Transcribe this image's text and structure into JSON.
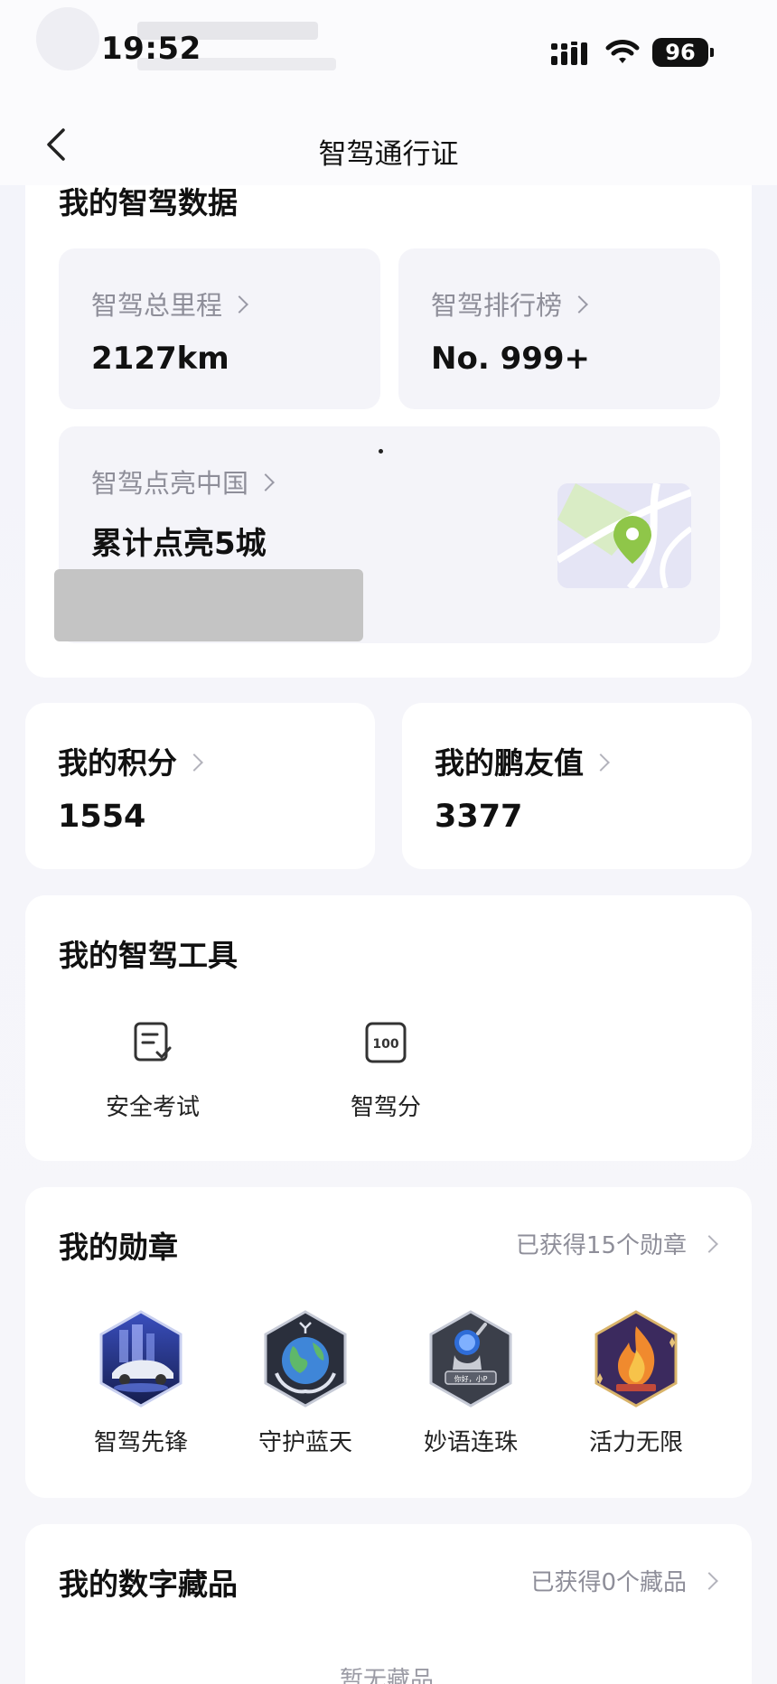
{
  "status_bar": {
    "time": "19:52",
    "battery": "96"
  },
  "nav": {
    "title": "智驾通行证"
  },
  "smart_driving": {
    "title": "我的智驾数据",
    "mileage": {
      "label": "智驾总里程",
      "value": "2127km"
    },
    "ranking": {
      "label": "智驾排行榜",
      "value": "No. 999+"
    },
    "light_china": {
      "label": "智驾点亮中国",
      "value": "累计点亮5城"
    }
  },
  "points": {
    "label": "我的积分",
    "value": "1554"
  },
  "friend_value": {
    "label": "我的鹏友值",
    "value": "3377"
  },
  "tools": {
    "title": "我的智驾工具",
    "items": [
      {
        "label": "安全考试",
        "icon": "exam-checklist-icon"
      },
      {
        "label": "智驾分",
        "icon": "score-100-icon",
        "badge": "100"
      }
    ]
  },
  "medals": {
    "title": "我的勋章",
    "summary": "已获得15个勋章",
    "items": [
      {
        "label": "智驾先锋",
        "icon": "car-pioneer-medal-icon"
      },
      {
        "label": "守护蓝天",
        "icon": "earth-guardian-medal-icon"
      },
      {
        "label": "妙语连珠",
        "icon": "astronaut-speech-medal-icon",
        "caption": "你好，小P"
      },
      {
        "label": "活力无限",
        "icon": "flame-vitality-medal-icon"
      }
    ]
  },
  "collectibles": {
    "title": "我的数字藏品",
    "summary": "已获得0个藏品",
    "empty": "暂无藏品"
  }
}
